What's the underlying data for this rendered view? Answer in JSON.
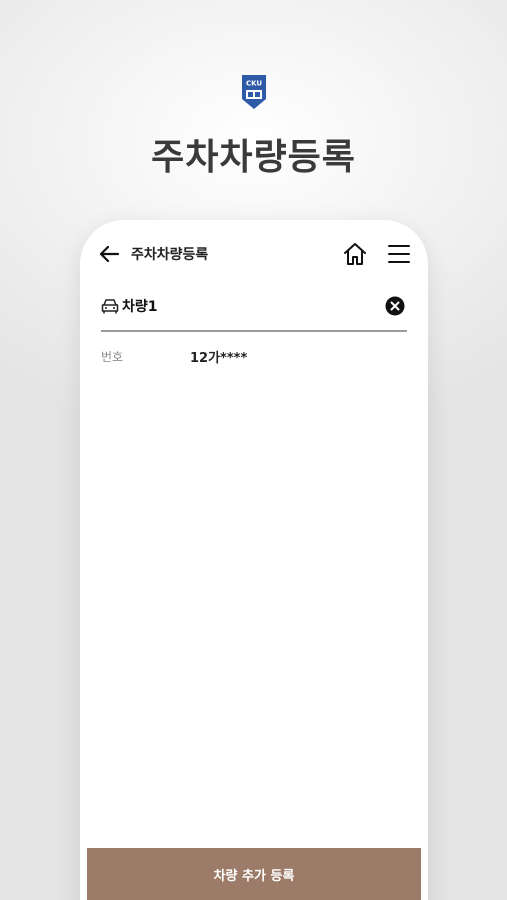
{
  "brand": {
    "logo_text": "CKU"
  },
  "hero": {
    "title": "주차차량등록"
  },
  "app_bar": {
    "back_icon": "arrow-left-icon",
    "title": "주차차량등록",
    "home_icon": "home-icon",
    "menu_icon": "menu-icon"
  },
  "vehicles": [
    {
      "icon": "car-icon",
      "name": "차량1",
      "remove_icon": "close-circle-icon",
      "fields": [
        {
          "label": "번호",
          "value": "12가****"
        }
      ]
    }
  ],
  "footer": {
    "add_button_label": "차량 추가 등록"
  },
  "colors": {
    "button_bg": "#9c7b68",
    "logo_blue": "#2f5aa8",
    "divider": "#9a9a9a"
  }
}
